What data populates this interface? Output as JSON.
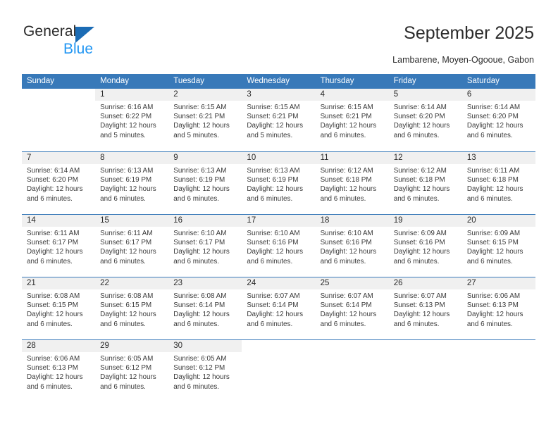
{
  "brand": {
    "name_top": "General",
    "name_bottom": "Blue",
    "triangle_color": "#1b6cb5",
    "blue_text_color": "#2196f3"
  },
  "header": {
    "title": "September 2025",
    "subtitle": "Lambarene, Moyen-Ogooue, Gabon"
  },
  "theme": {
    "header_bg": "#3879b9",
    "header_text": "#ffffff",
    "daynum_bg": "#f0f0f0",
    "cell_bg": "#ffffff",
    "row_border": "#3879b9"
  },
  "weekdays": [
    "Sunday",
    "Monday",
    "Tuesday",
    "Wednesday",
    "Thursday",
    "Friday",
    "Saturday"
  ],
  "weeks": [
    [
      {
        "day": "",
        "sunrise": "",
        "sunset": "",
        "daylight1": "",
        "daylight2": "",
        "blank": true
      },
      {
        "day": "1",
        "sunrise": "Sunrise: 6:16 AM",
        "sunset": "Sunset: 6:22 PM",
        "daylight1": "Daylight: 12 hours",
        "daylight2": "and 5 minutes."
      },
      {
        "day": "2",
        "sunrise": "Sunrise: 6:15 AM",
        "sunset": "Sunset: 6:21 PM",
        "daylight1": "Daylight: 12 hours",
        "daylight2": "and 5 minutes."
      },
      {
        "day": "3",
        "sunrise": "Sunrise: 6:15 AM",
        "sunset": "Sunset: 6:21 PM",
        "daylight1": "Daylight: 12 hours",
        "daylight2": "and 5 minutes."
      },
      {
        "day": "4",
        "sunrise": "Sunrise: 6:15 AM",
        "sunset": "Sunset: 6:21 PM",
        "daylight1": "Daylight: 12 hours",
        "daylight2": "and 6 minutes."
      },
      {
        "day": "5",
        "sunrise": "Sunrise: 6:14 AM",
        "sunset": "Sunset: 6:20 PM",
        "daylight1": "Daylight: 12 hours",
        "daylight2": "and 6 minutes."
      },
      {
        "day": "6",
        "sunrise": "Sunrise: 6:14 AM",
        "sunset": "Sunset: 6:20 PM",
        "daylight1": "Daylight: 12 hours",
        "daylight2": "and 6 minutes."
      }
    ],
    [
      {
        "day": "7",
        "sunrise": "Sunrise: 6:14 AM",
        "sunset": "Sunset: 6:20 PM",
        "daylight1": "Daylight: 12 hours",
        "daylight2": "and 6 minutes."
      },
      {
        "day": "8",
        "sunrise": "Sunrise: 6:13 AM",
        "sunset": "Sunset: 6:19 PM",
        "daylight1": "Daylight: 12 hours",
        "daylight2": "and 6 minutes."
      },
      {
        "day": "9",
        "sunrise": "Sunrise: 6:13 AM",
        "sunset": "Sunset: 6:19 PM",
        "daylight1": "Daylight: 12 hours",
        "daylight2": "and 6 minutes."
      },
      {
        "day": "10",
        "sunrise": "Sunrise: 6:13 AM",
        "sunset": "Sunset: 6:19 PM",
        "daylight1": "Daylight: 12 hours",
        "daylight2": "and 6 minutes."
      },
      {
        "day": "11",
        "sunrise": "Sunrise: 6:12 AM",
        "sunset": "Sunset: 6:18 PM",
        "daylight1": "Daylight: 12 hours",
        "daylight2": "and 6 minutes."
      },
      {
        "day": "12",
        "sunrise": "Sunrise: 6:12 AM",
        "sunset": "Sunset: 6:18 PM",
        "daylight1": "Daylight: 12 hours",
        "daylight2": "and 6 minutes."
      },
      {
        "day": "13",
        "sunrise": "Sunrise: 6:11 AM",
        "sunset": "Sunset: 6:18 PM",
        "daylight1": "Daylight: 12 hours",
        "daylight2": "and 6 minutes."
      }
    ],
    [
      {
        "day": "14",
        "sunrise": "Sunrise: 6:11 AM",
        "sunset": "Sunset: 6:17 PM",
        "daylight1": "Daylight: 12 hours",
        "daylight2": "and 6 minutes."
      },
      {
        "day": "15",
        "sunrise": "Sunrise: 6:11 AM",
        "sunset": "Sunset: 6:17 PM",
        "daylight1": "Daylight: 12 hours",
        "daylight2": "and 6 minutes."
      },
      {
        "day": "16",
        "sunrise": "Sunrise: 6:10 AM",
        "sunset": "Sunset: 6:17 PM",
        "daylight1": "Daylight: 12 hours",
        "daylight2": "and 6 minutes."
      },
      {
        "day": "17",
        "sunrise": "Sunrise: 6:10 AM",
        "sunset": "Sunset: 6:16 PM",
        "daylight1": "Daylight: 12 hours",
        "daylight2": "and 6 minutes."
      },
      {
        "day": "18",
        "sunrise": "Sunrise: 6:10 AM",
        "sunset": "Sunset: 6:16 PM",
        "daylight1": "Daylight: 12 hours",
        "daylight2": "and 6 minutes."
      },
      {
        "day": "19",
        "sunrise": "Sunrise: 6:09 AM",
        "sunset": "Sunset: 6:16 PM",
        "daylight1": "Daylight: 12 hours",
        "daylight2": "and 6 minutes."
      },
      {
        "day": "20",
        "sunrise": "Sunrise: 6:09 AM",
        "sunset": "Sunset: 6:15 PM",
        "daylight1": "Daylight: 12 hours",
        "daylight2": "and 6 minutes."
      }
    ],
    [
      {
        "day": "21",
        "sunrise": "Sunrise: 6:08 AM",
        "sunset": "Sunset: 6:15 PM",
        "daylight1": "Daylight: 12 hours",
        "daylight2": "and 6 minutes."
      },
      {
        "day": "22",
        "sunrise": "Sunrise: 6:08 AM",
        "sunset": "Sunset: 6:15 PM",
        "daylight1": "Daylight: 12 hours",
        "daylight2": "and 6 minutes."
      },
      {
        "day": "23",
        "sunrise": "Sunrise: 6:08 AM",
        "sunset": "Sunset: 6:14 PM",
        "daylight1": "Daylight: 12 hours",
        "daylight2": "and 6 minutes."
      },
      {
        "day": "24",
        "sunrise": "Sunrise: 6:07 AM",
        "sunset": "Sunset: 6:14 PM",
        "daylight1": "Daylight: 12 hours",
        "daylight2": "and 6 minutes."
      },
      {
        "day": "25",
        "sunrise": "Sunrise: 6:07 AM",
        "sunset": "Sunset: 6:14 PM",
        "daylight1": "Daylight: 12 hours",
        "daylight2": "and 6 minutes."
      },
      {
        "day": "26",
        "sunrise": "Sunrise: 6:07 AM",
        "sunset": "Sunset: 6:13 PM",
        "daylight1": "Daylight: 12 hours",
        "daylight2": "and 6 minutes."
      },
      {
        "day": "27",
        "sunrise": "Sunrise: 6:06 AM",
        "sunset": "Sunset: 6:13 PM",
        "daylight1": "Daylight: 12 hours",
        "daylight2": "and 6 minutes."
      }
    ],
    [
      {
        "day": "28",
        "sunrise": "Sunrise: 6:06 AM",
        "sunset": "Sunset: 6:13 PM",
        "daylight1": "Daylight: 12 hours",
        "daylight2": "and 6 minutes."
      },
      {
        "day": "29",
        "sunrise": "Sunrise: 6:05 AM",
        "sunset": "Sunset: 6:12 PM",
        "daylight1": "Daylight: 12 hours",
        "daylight2": "and 6 minutes."
      },
      {
        "day": "30",
        "sunrise": "Sunrise: 6:05 AM",
        "sunset": "Sunset: 6:12 PM",
        "daylight1": "Daylight: 12 hours",
        "daylight2": "and 6 minutes."
      },
      {
        "day": "",
        "sunrise": "",
        "sunset": "",
        "daylight1": "",
        "daylight2": "",
        "blank": true
      },
      {
        "day": "",
        "sunrise": "",
        "sunset": "",
        "daylight1": "",
        "daylight2": "",
        "blank": true
      },
      {
        "day": "",
        "sunrise": "",
        "sunset": "",
        "daylight1": "",
        "daylight2": "",
        "blank": true
      },
      {
        "day": "",
        "sunrise": "",
        "sunset": "",
        "daylight1": "",
        "daylight2": "",
        "blank": true
      }
    ]
  ]
}
